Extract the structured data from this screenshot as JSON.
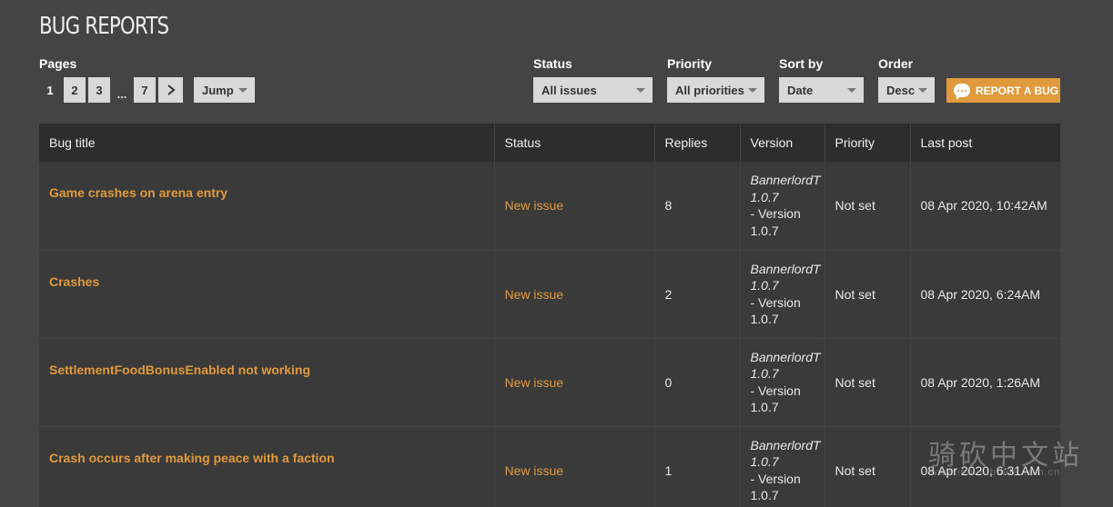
{
  "header": {
    "title": "BUG REPORTS"
  },
  "pages": {
    "label": "Pages",
    "items": [
      "1",
      "2",
      "3",
      "...",
      "7"
    ],
    "current": "1",
    "next_icon": "chevron-right-icon",
    "jump_label": "Jump"
  },
  "filters": {
    "status": {
      "label": "Status",
      "value": "All issues"
    },
    "priority": {
      "label": "Priority",
      "value": "All priorities"
    },
    "sort_by": {
      "label": "Sort by",
      "value": "Date"
    },
    "order": {
      "label": "Order",
      "value": "Desc"
    }
  },
  "report_button": {
    "label": "REPORT A BUG",
    "icon": "chat-bubble-icon",
    "color": "#e09a3c"
  },
  "table": {
    "columns": [
      "Bug title",
      "Status",
      "Replies",
      "Version",
      "Priority",
      "Last post"
    ],
    "rows": [
      {
        "title": "Game crashes on arena entry",
        "status": "New issue",
        "replies": "8",
        "version_italic": "BannerlordT 1.0.7",
        "version_rest": "- Version 1.0.7",
        "priority": "Not set",
        "last_post": "08 Apr 2020, 10:42AM"
      },
      {
        "title": "Crashes",
        "status": "New issue",
        "replies": "2",
        "version_italic": "BannerlordT 1.0.7",
        "version_rest": "- Version 1.0.7",
        "priority": "Not set",
        "last_post": "08 Apr 2020, 6:24AM"
      },
      {
        "title": "SettlementFoodBonusEnabled not working",
        "status": "New issue",
        "replies": "0",
        "version_italic": "BannerlordT 1.0.7",
        "version_rest": "- Version 1.0.7",
        "priority": "Not set",
        "last_post": "08 Apr 2020, 1:26AM"
      },
      {
        "title": "Crash occurs after making peace with a faction",
        "status": "New issue",
        "replies": "1",
        "version_italic": "BannerlordT 1.0.7",
        "version_rest": "- Version 1.0.7",
        "priority": "Not set",
        "last_post": "08 Apr 2020, 6:31AM"
      }
    ]
  },
  "watermark": {
    "text": "骑砍中文站",
    "sub": "www.mountblade.com.cn"
  }
}
